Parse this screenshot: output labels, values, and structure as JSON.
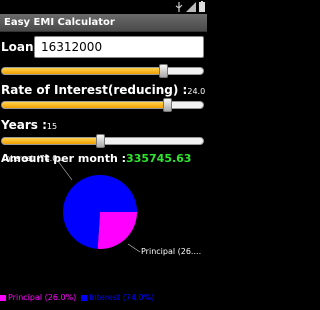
{
  "app": {
    "title": "Easy EMI Calculator"
  },
  "loan": {
    "label": "Loan :",
    "value": "16312000",
    "slider_fraction": 0.8
  },
  "interest": {
    "label": "Rate of Interest(reducing) :",
    "value": "24.0",
    "slider_fraction": 0.82
  },
  "years": {
    "label": "Years :",
    "value": "15",
    "slider_fraction": 0.49
  },
  "amount": {
    "label": "Amount per month :",
    "value": "335745.63",
    "color": "#2ee62e"
  },
  "chart_data": {
    "type": "pie",
    "slices": [
      {
        "name": "Interest",
        "value": 74.0,
        "color": "#0000ff",
        "pie_label": "Interest (74.0...",
        "legend_label": "Interest (74.0%)"
      },
      {
        "name": "Principal",
        "value": 26.0,
        "color": "#ff00ff",
        "pie_label": "Principal (26....",
        "legend_label": "Principal (26.0%)"
      }
    ]
  },
  "icons": {
    "usb": "usb-icon",
    "signal": "signal-icon",
    "battery": "battery-icon"
  }
}
